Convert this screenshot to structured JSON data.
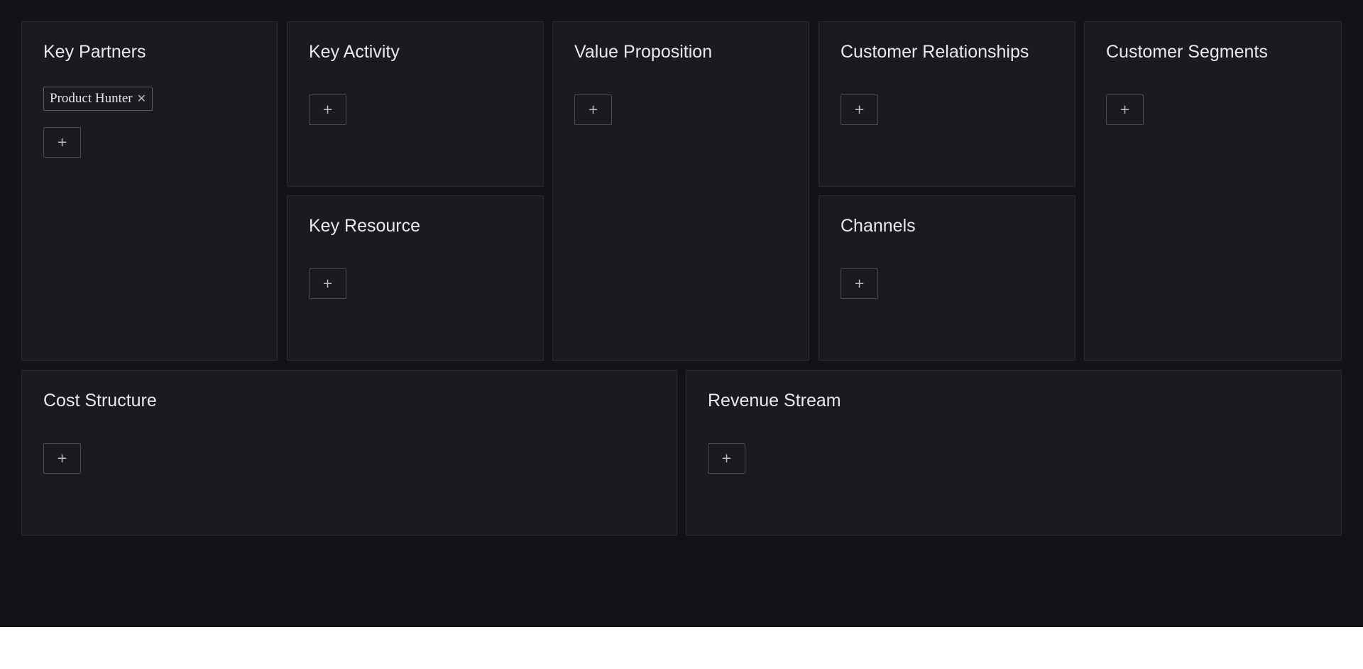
{
  "canvas": {
    "key_partners": {
      "title": "Key Partners",
      "tags": [
        {
          "label": "Product Hunter",
          "close_icon": "close-icon"
        }
      ],
      "add_label": "+"
    },
    "key_activity": {
      "title": "Key Activity",
      "add_label": "+"
    },
    "key_resource": {
      "title": "Key Resource",
      "add_label": "+"
    },
    "value_proposition": {
      "title": "Value Proposition",
      "add_label": "+"
    },
    "customer_relationships": {
      "title": "Customer Relationships",
      "add_label": "+"
    },
    "channels": {
      "title": "Channels",
      "add_label": "+"
    },
    "customer_segments": {
      "title": "Customer Segments",
      "add_label": "+"
    },
    "cost_structure": {
      "title": "Cost Structure",
      "add_label": "+"
    },
    "revenue_stream": {
      "title": "Revenue Stream",
      "add_label": "+"
    }
  },
  "icons": {
    "add": "plus-icon",
    "remove_tag": "close-icon"
  },
  "colors": {
    "page_background": "#131317",
    "panel_background": "#1b1b1f",
    "panel_border": "#2a2a2f",
    "text": "#e9e9ec",
    "button_border": "#4a4a50"
  }
}
